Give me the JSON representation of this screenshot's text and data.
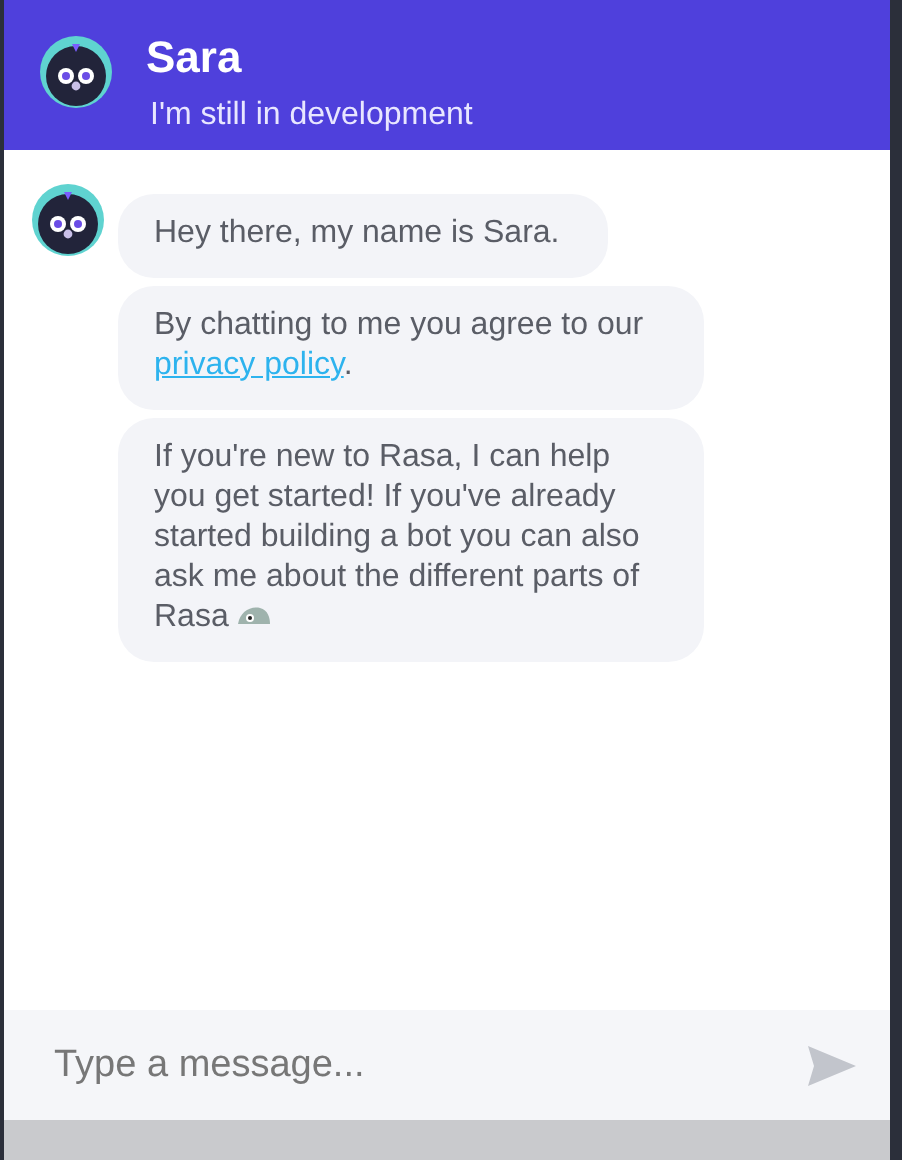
{
  "header": {
    "title": "Sara",
    "subtitle": "I'm still in development"
  },
  "messages": [
    {
      "text": "Hey there, my name is Sara.",
      "trailing_icon": false
    },
    {
      "text": "By chatting to me you agree to our ",
      "link": "privacy policy",
      "after": ".",
      "trailing_icon": false
    },
    {
      "text": "If you're new to Rasa, I can help you get started! If you've already started building a bot you can also ask me about the different parts of Rasa",
      "trailing_icon": true
    }
  ],
  "composer": {
    "placeholder": "Type a message..."
  }
}
